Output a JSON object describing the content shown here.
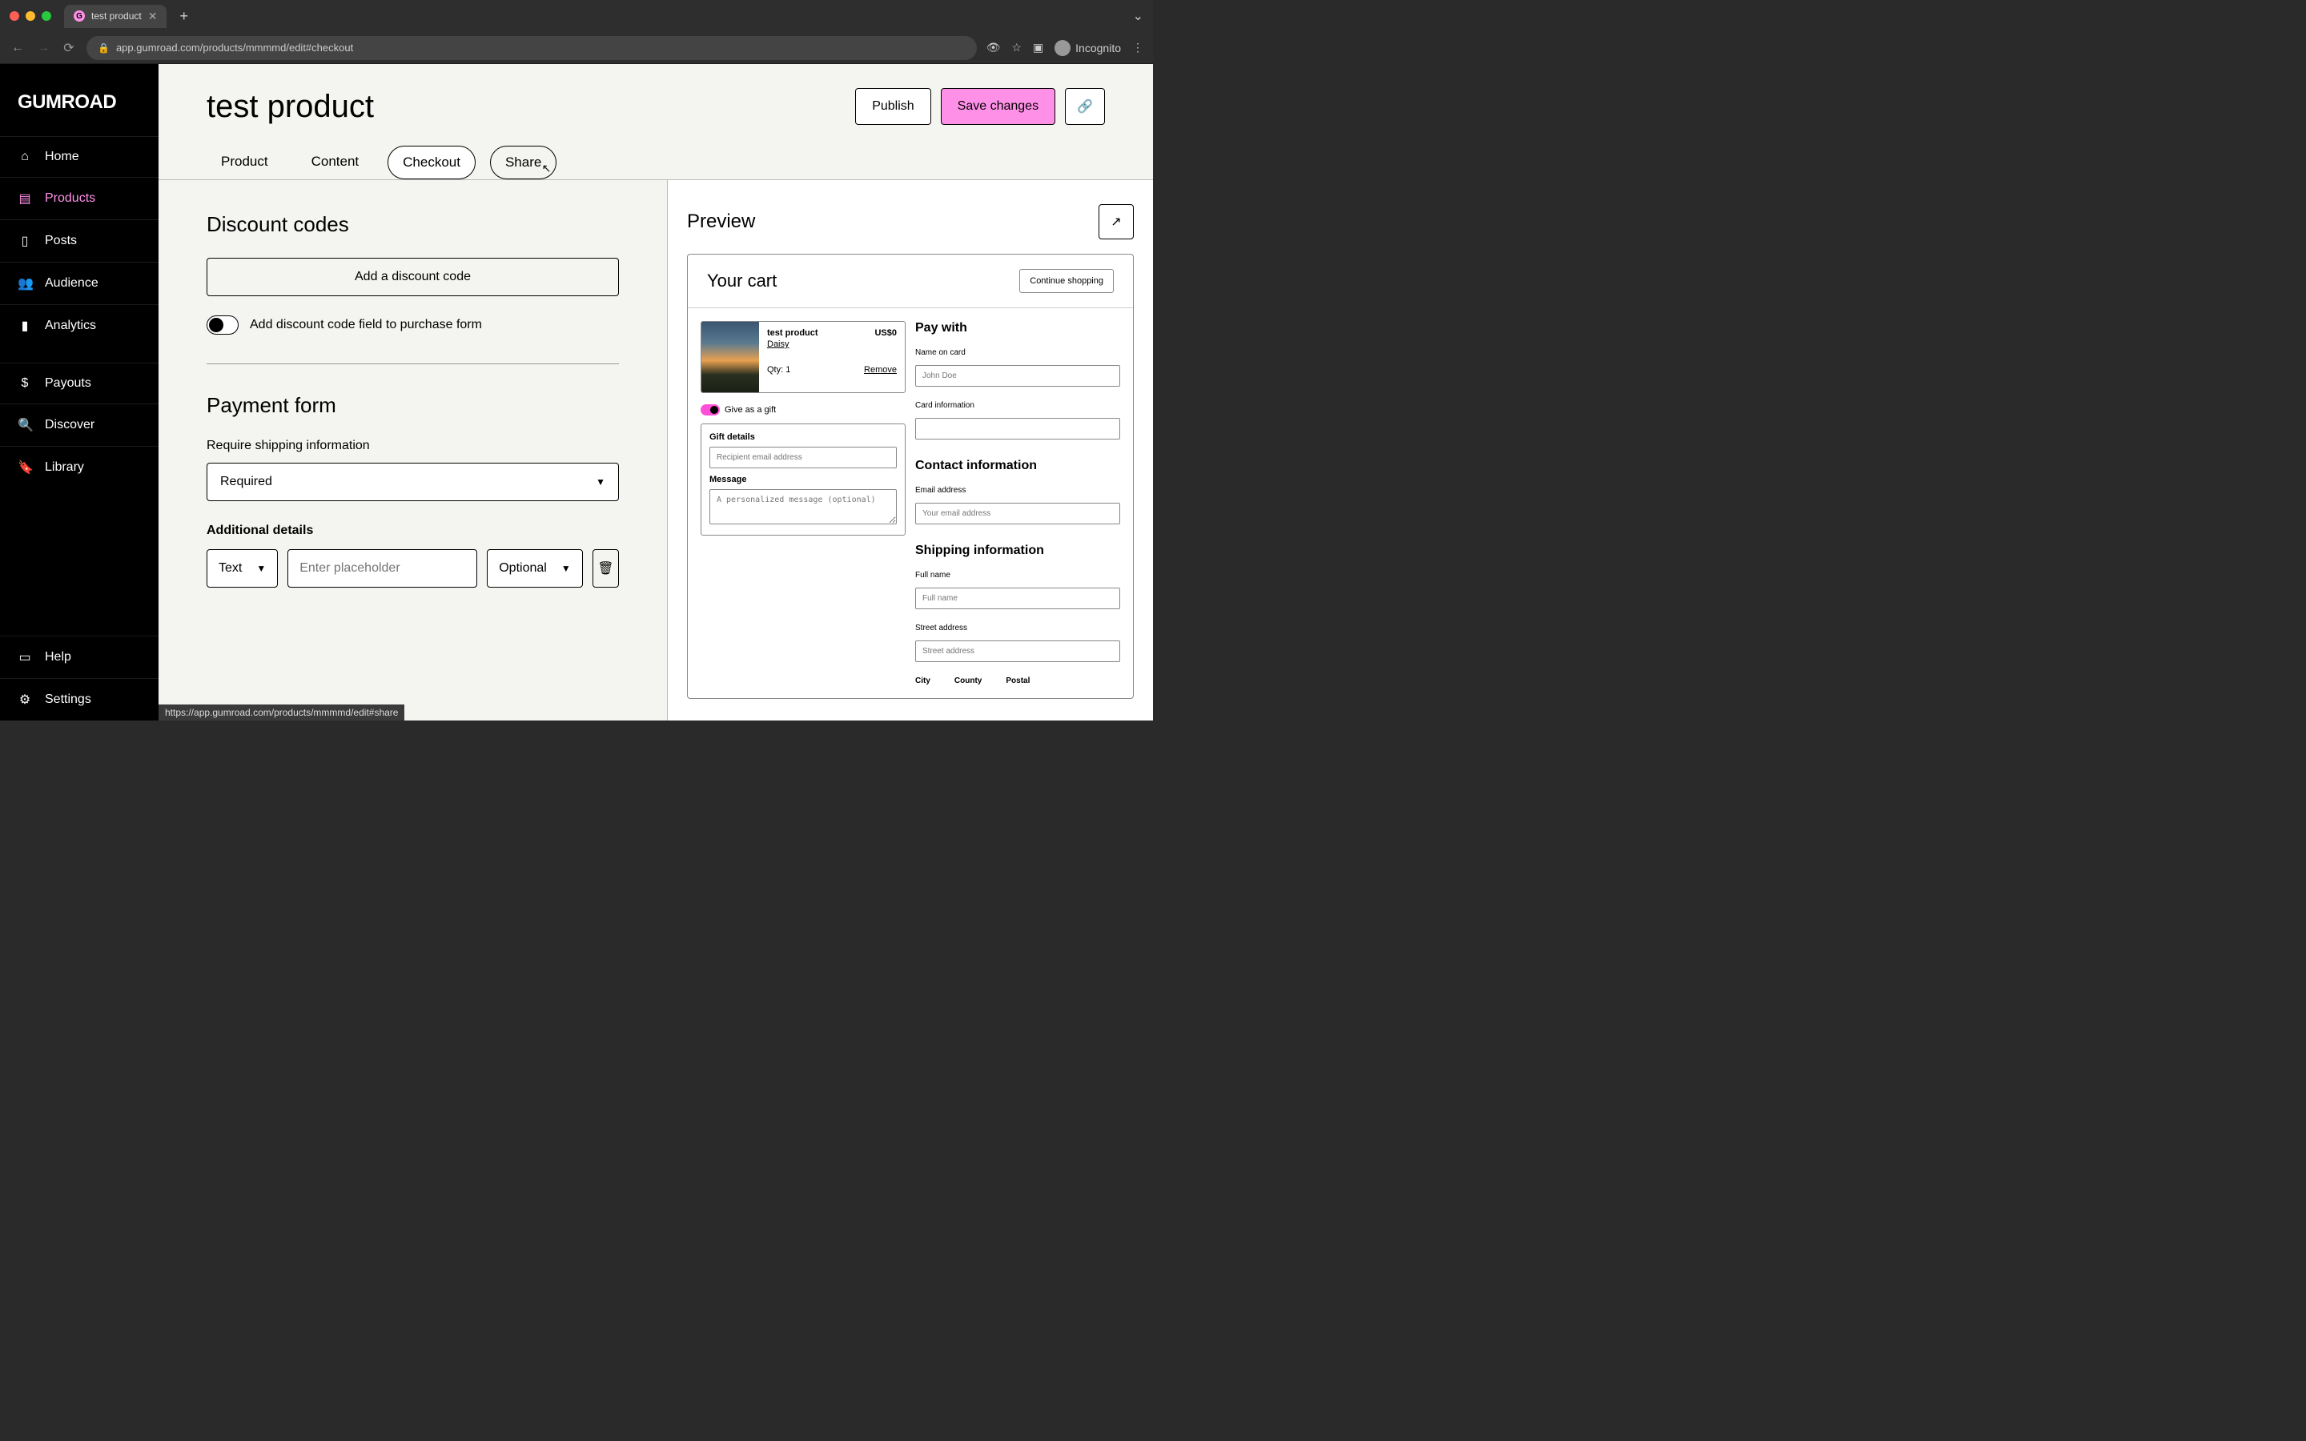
{
  "browser": {
    "tab_title": "test product",
    "url": "app.gumroad.com/products/mmmmd/edit#checkout",
    "incognito_label": "Incognito",
    "status_url": "https://app.gumroad.com/products/mmmmd/edit#share"
  },
  "brand": "GUMROAD",
  "sidebar": {
    "items": [
      {
        "label": "Home"
      },
      {
        "label": "Products"
      },
      {
        "label": "Posts"
      },
      {
        "label": "Audience"
      },
      {
        "label": "Analytics"
      },
      {
        "label": "Payouts"
      },
      {
        "label": "Discover"
      },
      {
        "label": "Library"
      },
      {
        "label": "Help"
      },
      {
        "label": "Settings"
      }
    ]
  },
  "header": {
    "title": "test product",
    "publish": "Publish",
    "save": "Save changes"
  },
  "tabs": {
    "product": "Product",
    "content": "Content",
    "checkout": "Checkout",
    "share": "Share"
  },
  "discount": {
    "heading": "Discount codes",
    "add_btn": "Add a discount code",
    "toggle_label": "Add discount code field to purchase form"
  },
  "payment": {
    "heading": "Payment form",
    "shipping_label": "Require shipping information",
    "shipping_value": "Required",
    "additional_label": "Additional details",
    "detail_type": "Text",
    "detail_placeholder": "Enter placeholder",
    "detail_required": "Optional"
  },
  "preview": {
    "title": "Preview",
    "cart_title": "Your cart",
    "continue": "Continue shopping",
    "product_name": "test product",
    "product_price": "US$0",
    "seller": "Daisy",
    "qty_label": "Qty:",
    "qty_value": "1",
    "remove": "Remove",
    "gift_label": "Give as a gift",
    "gift_details": "Gift details",
    "recipient_ph": "Recipient email address",
    "message_label": "Message",
    "message_ph": "A personalized message (optional)",
    "pay_with": "Pay with",
    "name_on_card": "Name on card",
    "name_ph": "John Doe",
    "card_info": "Card information",
    "contact_info": "Contact information",
    "email_label": "Email address",
    "email_ph": "Your email address",
    "shipping_info": "Shipping information",
    "fullname_label": "Full name",
    "fullname_ph": "Full name",
    "street_label": "Street address",
    "street_ph": "Street address",
    "city": "City",
    "county": "County",
    "postal": "Postal"
  },
  "colors": {
    "accent": "#ff90e8"
  }
}
